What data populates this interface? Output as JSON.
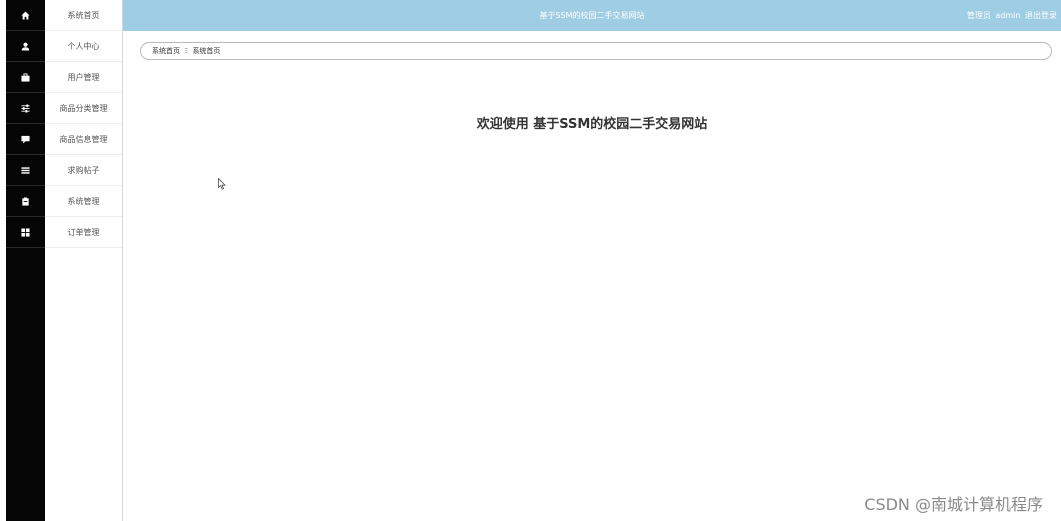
{
  "header": {
    "title": "基于SSM的校园二手交易网站",
    "user_label": "管理员",
    "username": "admin",
    "logout_label": "退出登录",
    "background": "#9fcde3"
  },
  "sidebar": {
    "items": [
      {
        "label": "系统首页",
        "icon": "home-icon"
      },
      {
        "label": "个人中心",
        "icon": "user-icon"
      },
      {
        "label": "用户管理",
        "icon": "briefcase-icon"
      },
      {
        "label": "商品分类管理",
        "icon": "sliders-icon"
      },
      {
        "label": "商品信息管理",
        "icon": "comment-icon"
      },
      {
        "label": "求购帖子",
        "icon": "list-icon"
      },
      {
        "label": "系统管理",
        "icon": "clipboard-icon"
      },
      {
        "label": "订单管理",
        "icon": "grid-icon"
      }
    ]
  },
  "breadcrumb": {
    "home": "系统首页",
    "separator": "Ξ",
    "current": "系统首页"
  },
  "main": {
    "welcome": "欢迎使用 基于SSM的校园二手交易网站"
  },
  "watermark": "CSDN @南城计算机程序"
}
